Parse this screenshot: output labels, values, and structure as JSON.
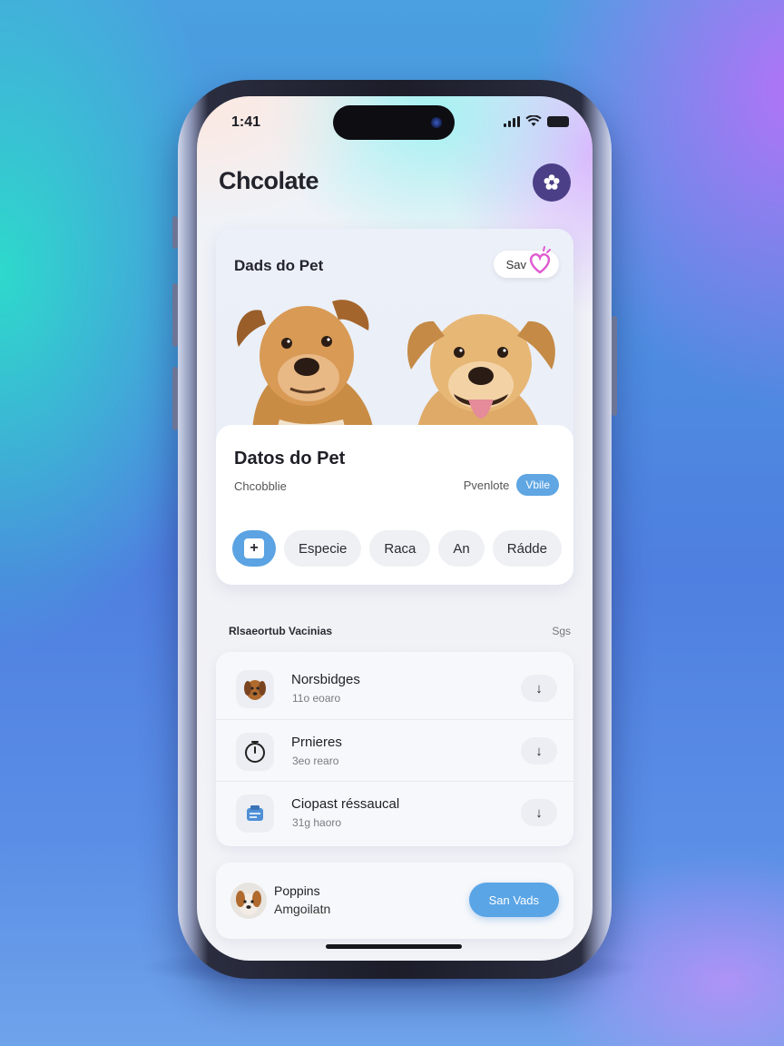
{
  "status_bar": {
    "time": "1:41"
  },
  "header": {
    "title": "Chcolate",
    "settings_icon": "flower-gear-icon"
  },
  "pet_card": {
    "title": "Dads do Pet",
    "save_label": "Sav",
    "details": {
      "title": "Datos do Pet",
      "name": "Chcobblie",
      "tag_label": "Pvenlote",
      "tag_badge": "Vbile"
    },
    "chips": {
      "add_symbol": "+",
      "items": [
        "Especie",
        "Raca",
        "An",
        "Rádde"
      ]
    }
  },
  "vaccines": {
    "section_title": "Rlsaeortub Vacinias",
    "section_link": "Sgs",
    "items": [
      {
        "name": "Norsbidges",
        "sub": "11o eoaro",
        "icon": "dog-photo-icon",
        "action": "↓"
      },
      {
        "name": "Prnieres",
        "sub": "3eo rearo",
        "icon": "timer-icon",
        "action": "↓"
      },
      {
        "name": "Ciopast réssaucal",
        "sub": "31g haoro",
        "icon": "clipboard-icon",
        "action": "↓"
      }
    ]
  },
  "bottom": {
    "name": "Poppins",
    "sub": "Amgoilatn",
    "button": "San Vads"
  },
  "colors": {
    "accent": "#5aa5e6",
    "settings_bg": "#4b3f88",
    "heart": "#e05ad0"
  }
}
